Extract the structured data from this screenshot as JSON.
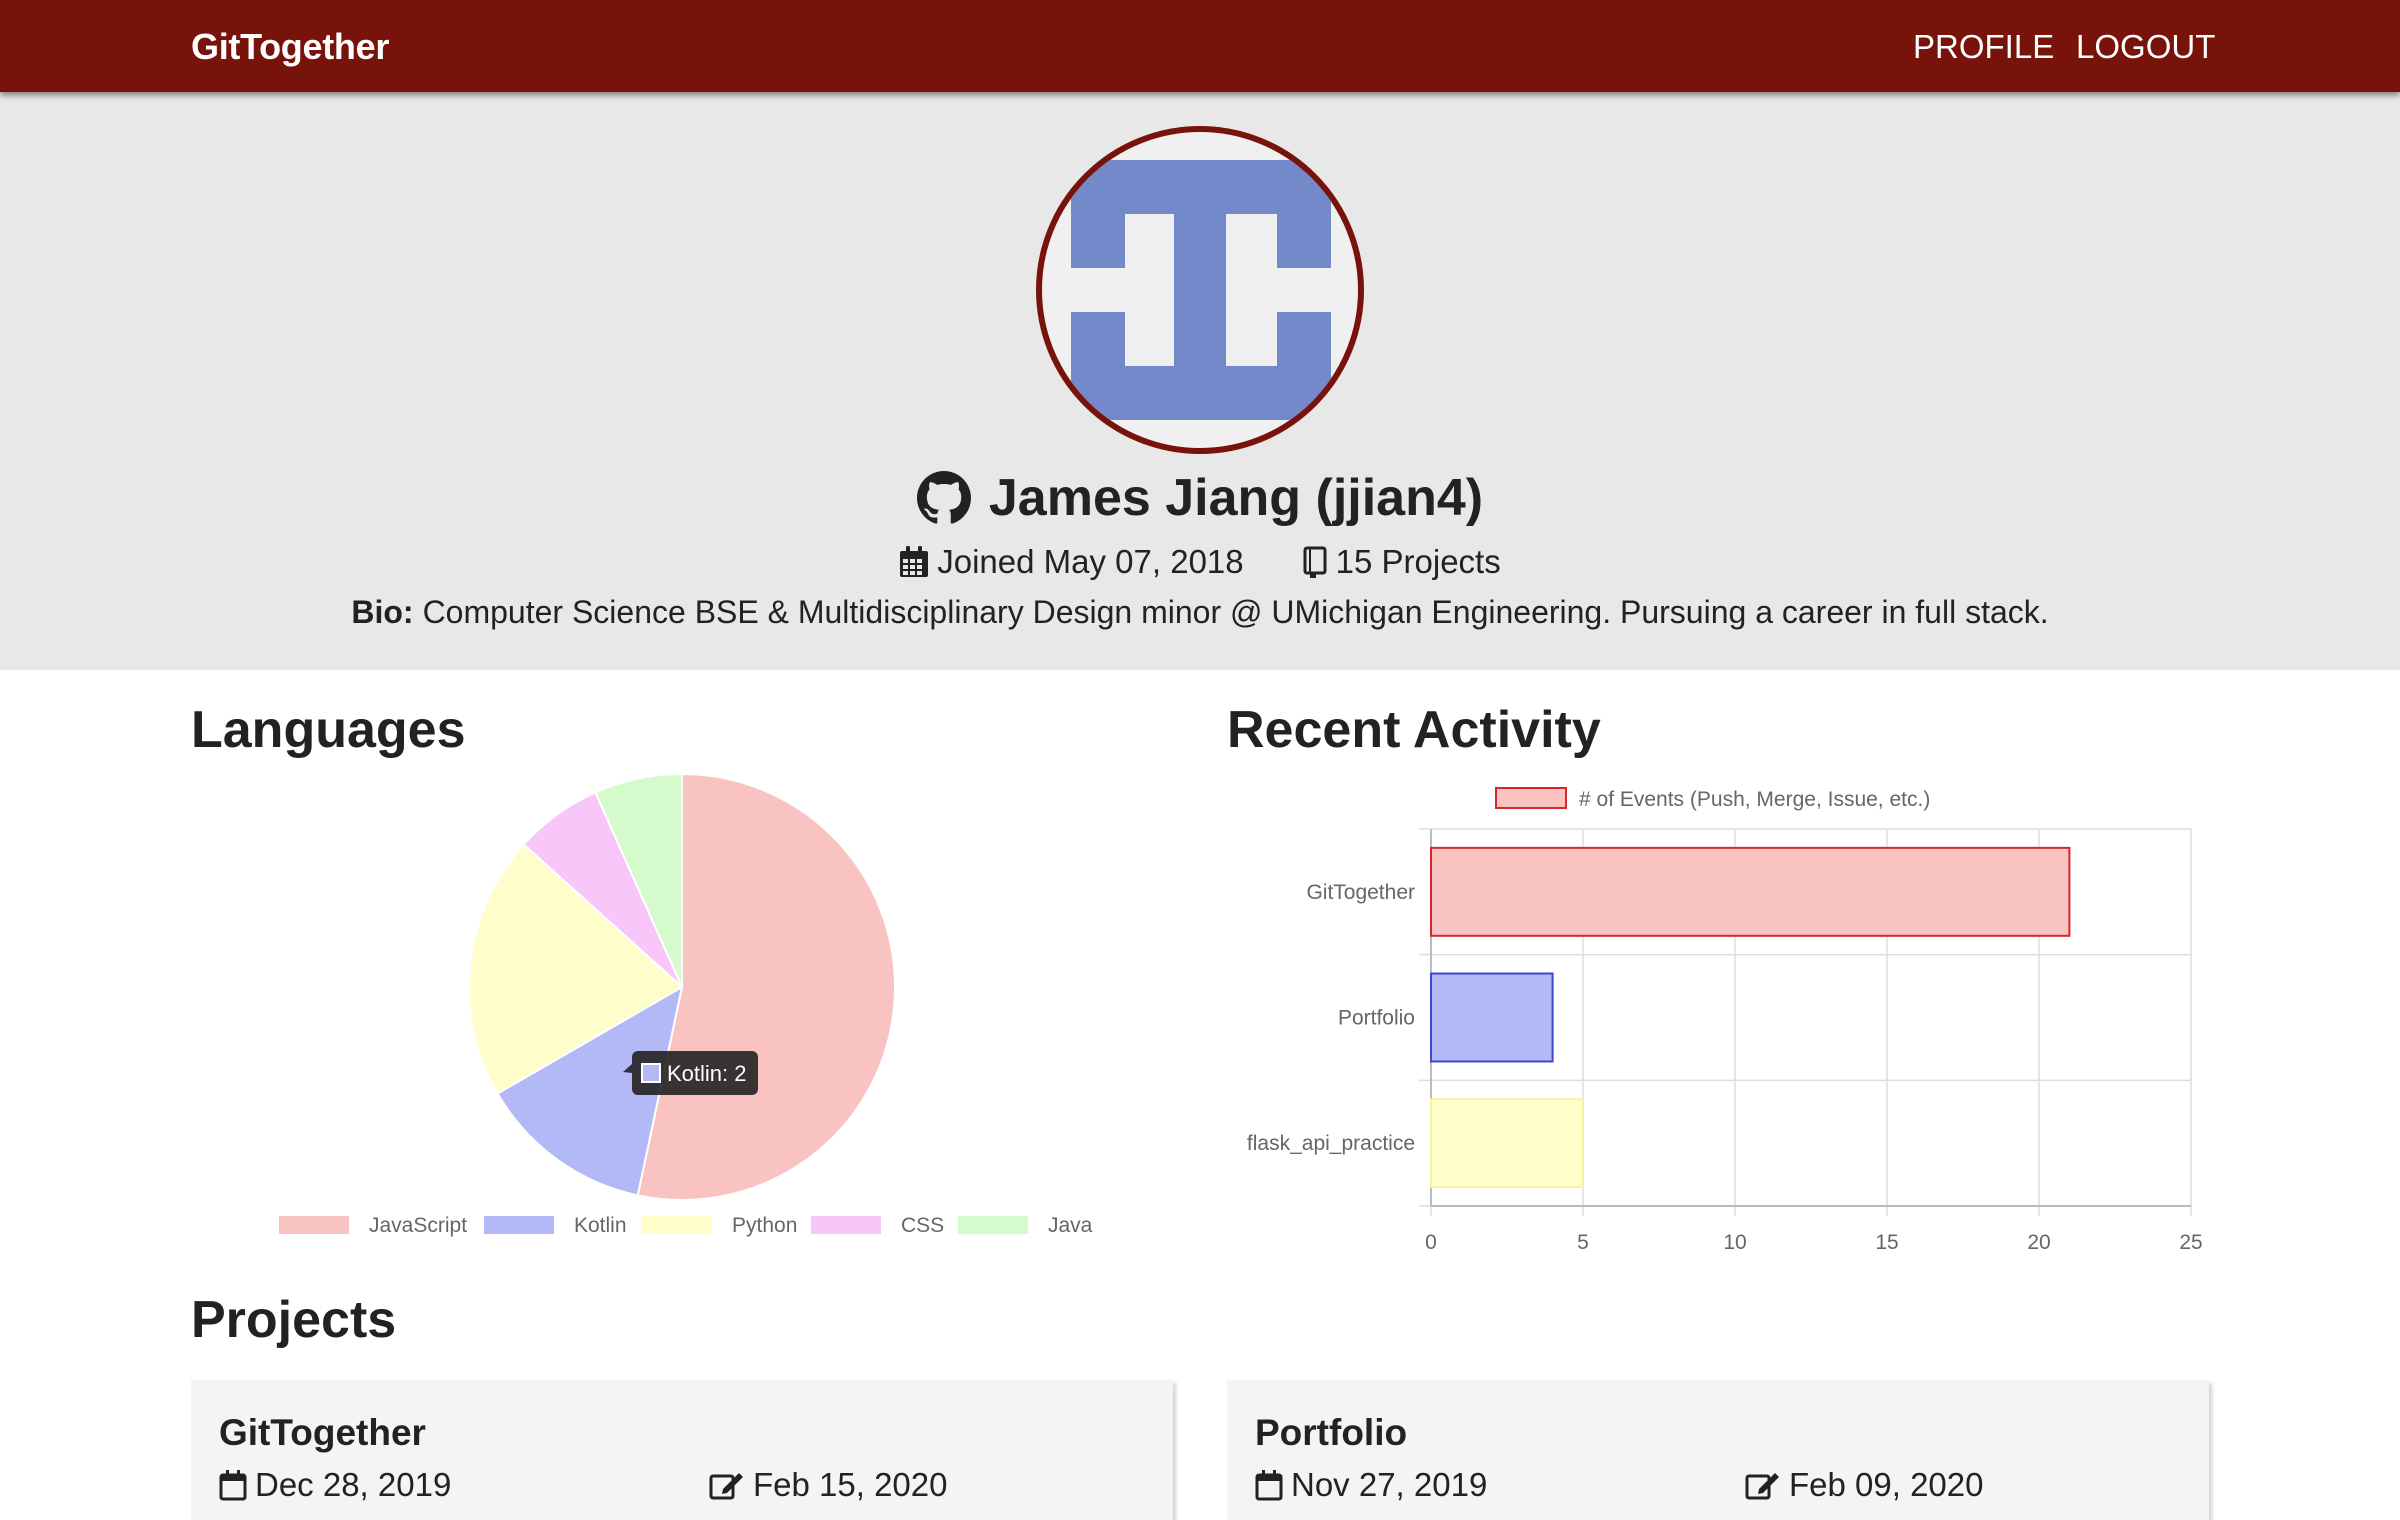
{
  "navbar": {
    "brand": "GitTogether",
    "links": [
      {
        "label": "PROFILE"
      },
      {
        "label": "LOGOUT"
      }
    ]
  },
  "profile": {
    "name": "James Jiang (jjian4)",
    "joined": "Joined May 07, 2018",
    "projects_count": "15 Projects",
    "bio_label": "Bio:",
    "bio": "Computer Science BSE & Multidisciplinary Design minor @ UMichigan Engineering. Pursuing a career in full stack.",
    "github_icon": "github-icon",
    "calendar_icon": "calendar-icon",
    "book_icon": "book-icon",
    "avatar_colors": {
      "ring": "#78130c",
      "fill": "#7489c9",
      "bg": "#f0f0f0"
    }
  },
  "sections": {
    "languages": "Languages",
    "activity": "Recent Activity",
    "projects": "Projects"
  },
  "tooltip": {
    "text": "Kotlin: 2"
  },
  "chart_data": [
    {
      "type": "pie",
      "title": "",
      "categories": [
        "JavaScript",
        "Kotlin",
        "Python",
        "CSS",
        "Java"
      ],
      "values": [
        8,
        2,
        3,
        1,
        1
      ],
      "colors": [
        "#f8c3c0",
        "#b2b9f6",
        "#fffdc9",
        "#f9c6fa",
        "#d5fbcc"
      ],
      "legend": "bottom",
      "tooltip": "Kotlin: 2"
    },
    {
      "type": "bar",
      "orientation": "horizontal",
      "categories": [
        "GitTogether",
        "Portfolio",
        "flask_api_practice"
      ],
      "series": [
        {
          "name": "# of Events (Push, Merge, Issue, etc.)",
          "values": [
            21,
            4,
            5
          ]
        }
      ],
      "colors": [
        "#f8c3c0",
        "#b2b9f6",
        "#fffdc9"
      ],
      "border_colors": [
        "#d9262b",
        "#3f47c7",
        "#f7f2a2"
      ],
      "xlim": [
        0,
        25
      ],
      "xticks": [
        "0",
        "5",
        "10",
        "15",
        "20",
        "25"
      ],
      "grid": true,
      "legend": "top"
    }
  ],
  "projects": [
    {
      "name": "GitTogether",
      "created": "Dec 28, 2019",
      "updated": "Feb 15, 2020"
    },
    {
      "name": "Portfolio",
      "created": "Nov 27, 2019",
      "updated": "Feb 09, 2020"
    }
  ]
}
